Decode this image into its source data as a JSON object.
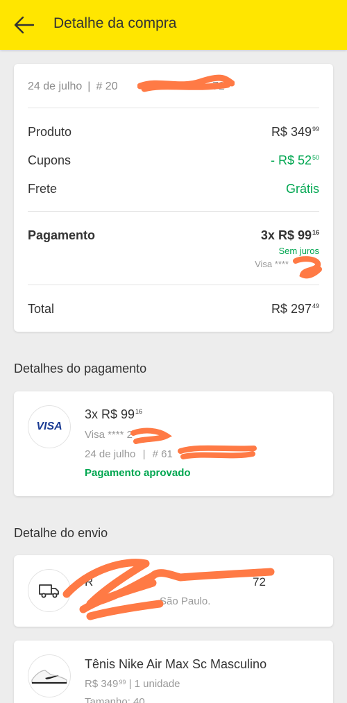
{
  "appbar": {
    "title": "Detalhe da compra",
    "back_icon": "arrow-left-icon"
  },
  "summary": {
    "date": "24 de julho",
    "order_separator": "|",
    "order_prefix": "# 20",
    "order_suffix": "72",
    "produto_label": "Produto",
    "produto_int": "R$ 349",
    "produto_cents": "99",
    "cupons_label": "Cupons",
    "cupons_int": "- R$ 52",
    "cupons_cents": "50",
    "frete_label": "Frete",
    "frete_value": "Grátis",
    "pagamento_label": "Pagamento",
    "pagamento_int": "3x R$ 99",
    "pagamento_cents": "16",
    "sem_juros": "Sem juros",
    "card_masked": "Visa ****",
    "total_label": "Total",
    "total_int": "R$ 297",
    "total_cents": "49"
  },
  "payment_details": {
    "section_title": "Detalhes do pagamento",
    "brand": "VISA",
    "amount_int": "3x R$ 99",
    "amount_cents": "16",
    "card_masked": "Visa ****",
    "card_suffix": "2",
    "date": "24 de julho",
    "separator": "|",
    "operation_prefix": "# 61",
    "status": "Pagamento aprovado"
  },
  "shipping": {
    "section_title": "Detalhe do envio",
    "address_prefix": "R",
    "address_suffix": "72",
    "city": "São Paulo."
  },
  "product": {
    "name": "Tênis Nike Air Max Sc Masculino",
    "price_int": "R$ 349",
    "price_cents": "99",
    "quantity": "| 1 unidade",
    "size": "Tamanho: 40"
  },
  "colors": {
    "accent_yellow": "#ffe600",
    "green": "#00a650",
    "redaction": "#ff7a45"
  }
}
